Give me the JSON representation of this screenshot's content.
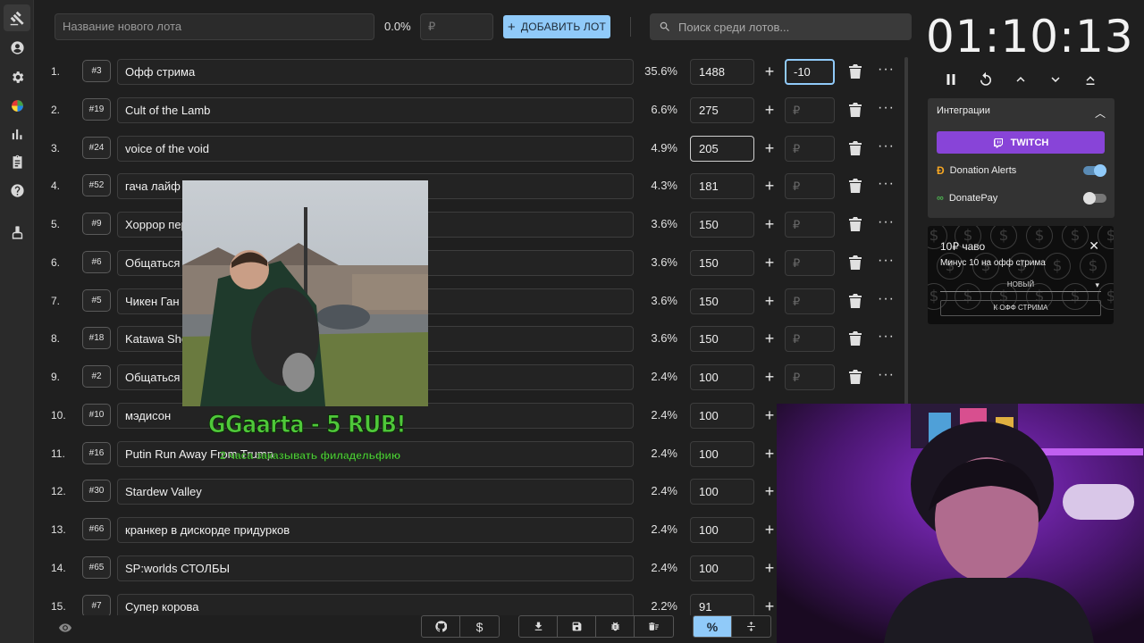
{
  "sidebar": {
    "icons": [
      "gavel-icon",
      "account-icon",
      "settings-icon",
      "wheel-icon",
      "stats-icon",
      "clipboard-icon",
      "help-icon",
      "cleanup-icon"
    ]
  },
  "topbar": {
    "name_placeholder": "Название нового лота",
    "percent": "0.0%",
    "currency_placeholder": "₽",
    "add_button": "ДОБАВИТЬ ЛОТ",
    "search_placeholder": "Поиск среди лотов..."
  },
  "lots": [
    {
      "num": "1.",
      "id": "#3",
      "name": "Офф стрима",
      "pct": "35.6%",
      "amount": "1488",
      "add": "-10"
    },
    {
      "num": "2.",
      "id": "#19",
      "name": "Cult of the Lamb",
      "pct": "6.6%",
      "amount": "275",
      "add": "₽"
    },
    {
      "num": "3.",
      "id": "#24",
      "name": "voice of the void",
      "pct": "4.9%",
      "amount": "205",
      "add": "₽"
    },
    {
      "num": "4.",
      "id": "#52",
      "name": "гача лайф",
      "pct": "4.3%",
      "amount": "181",
      "add": "₽"
    },
    {
      "num": "5.",
      "id": "#9",
      "name": "Хоррор пер",
      "pct": "3.6%",
      "amount": "150",
      "add": "₽"
    },
    {
      "num": "6.",
      "id": "#6",
      "name": "Общаться",
      "pct": "3.6%",
      "amount": "150",
      "add": "₽"
    },
    {
      "num": "7.",
      "id": "#5",
      "name": "Чикен Ган",
      "pct": "3.6%",
      "amount": "150",
      "add": "₽"
    },
    {
      "num": "8.",
      "id": "#18",
      "name": "Katawa Sho",
      "pct": "3.6%",
      "amount": "150",
      "add": "₽"
    },
    {
      "num": "9.",
      "id": "#2",
      "name": "Общаться",
      "pct": "2.4%",
      "amount": "100",
      "add": "₽"
    },
    {
      "num": "10.",
      "id": "#10",
      "name": "мэдисон",
      "pct": "2.4%",
      "amount": "100",
      "add": ""
    },
    {
      "num": "11.",
      "id": "#16",
      "name": "Putin Run Away From Trump",
      "pct": "2.4%",
      "amount": "100",
      "add": ""
    },
    {
      "num": "12.",
      "id": "#30",
      "name": "Stardew Valley",
      "pct": "2.4%",
      "amount": "100",
      "add": ""
    },
    {
      "num": "13.",
      "id": "#66",
      "name": "кранкер в дискорде придурков",
      "pct": "2.4%",
      "amount": "100",
      "add": ""
    },
    {
      "num": "14.",
      "id": "#65",
      "name": "SP:worlds СТОЛБЫ",
      "pct": "2.4%",
      "amount": "100",
      "add": ""
    },
    {
      "num": "15.",
      "id": "#7",
      "name": "Супер корова",
      "pct": "2.2%",
      "amount": "91",
      "add": ""
    }
  ],
  "timer": {
    "display": "01:10:13"
  },
  "integrations": {
    "title": "Интеграции",
    "twitch_label": "TWITCH",
    "donation_alerts": {
      "label": "Donation Alerts",
      "enabled": true
    },
    "donatepay": {
      "label": "DonatePay",
      "enabled": false
    }
  },
  "donation_card": {
    "title": "10₽ чаво",
    "message": "Минус 10 на офф стрима",
    "select_value": "НОВЫЙ",
    "action_button": "К ОФФ СТРИМА"
  },
  "alert": {
    "title": "GGaarta - 5 RUB!",
    "message": "2 часа заказывать филадельфию"
  },
  "colors": {
    "accent": "#90caf9",
    "twitch": "#8844d8",
    "alert_green": "#4fc73a"
  }
}
